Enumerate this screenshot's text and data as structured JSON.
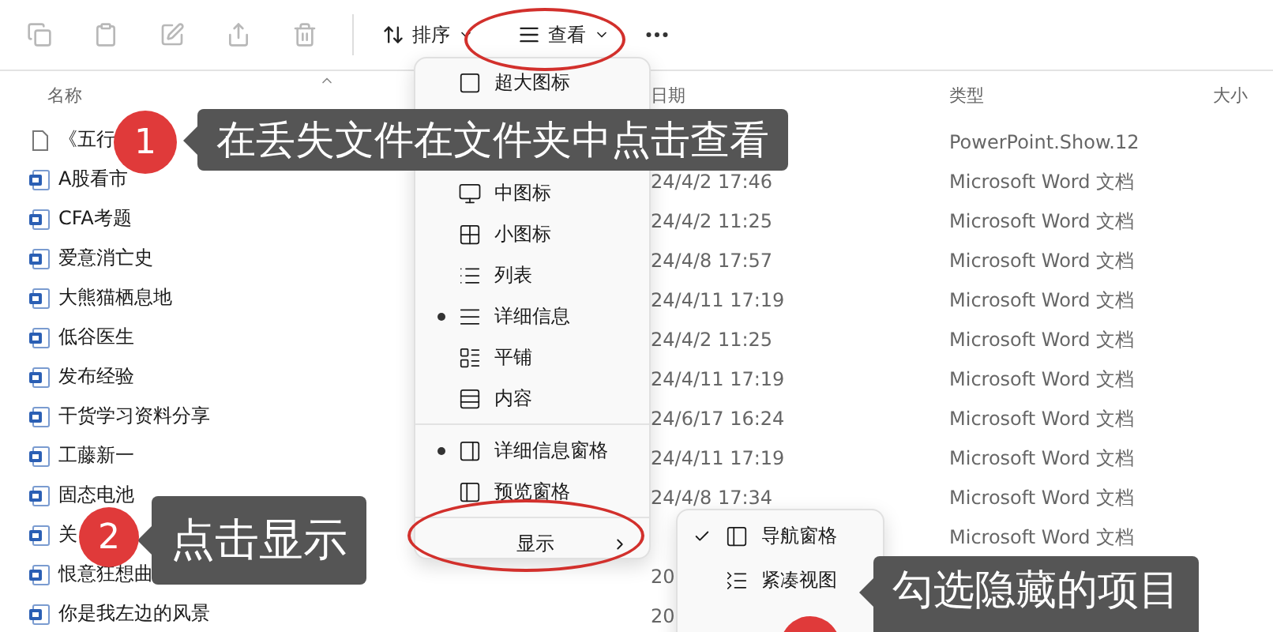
{
  "toolbar": {
    "icon_buttons": [
      {
        "disabled": true
      },
      {
        "disabled": true
      },
      {
        "disabled": true
      },
      {
        "disabled": true
      },
      {
        "disabled": true
      }
    ],
    "sort": {
      "label": "排序"
    },
    "view": {
      "label": "查看",
      "highlighted": true
    }
  },
  "table": {
    "columns": [
      "名称",
      "日期",
      "类型",
      "大小"
    ],
    "rows": [
      {
        "kind": "blank",
        "name": "《五行",
        "type": "PowerPoint.Show.12"
      },
      {
        "kind": "word",
        "name": "A股看市",
        "date": "24/4/2 17:46",
        "type": "Microsoft Word 文档"
      },
      {
        "kind": "word",
        "name": "CFA考题",
        "date": "24/4/2 11:25",
        "type": "Microsoft Word 文档"
      },
      {
        "kind": "word",
        "name": "爱意消亡史",
        "date": "24/4/8 17:57",
        "type": "Microsoft Word 文档"
      },
      {
        "kind": "word",
        "name": "大熊猫栖息地",
        "date": "24/4/11 17:19",
        "type": "Microsoft Word 文档"
      },
      {
        "kind": "word",
        "name": "低谷医生",
        "date": "24/4/2 11:25",
        "type": "Microsoft Word 文档"
      },
      {
        "kind": "word",
        "name": "发布经验",
        "date": "24/4/11 17:19",
        "type": "Microsoft Word 文档"
      },
      {
        "kind": "word",
        "name": "干货学习资料分享",
        "date": "24/6/17 16:24",
        "type": "Microsoft Word 文档"
      },
      {
        "kind": "word",
        "name": "工藤新一",
        "date": "24/4/11 17:19",
        "type": "Microsoft Word 文档"
      },
      {
        "kind": "word",
        "name": "固态电池",
        "date": "24/4/8 17:34",
        "type": "Microsoft Word 文档"
      },
      {
        "kind": "word",
        "name": "关",
        "type": "Microsoft Word 文档"
      },
      {
        "kind": "word",
        "name": "恨意狂想曲",
        "date": "20"
      },
      {
        "kind": "word",
        "name": "你是我左边的风景",
        "date": "20"
      }
    ]
  },
  "view_menu": {
    "items": [
      {
        "kind": "option",
        "label": "超大图标",
        "selected": false
      },
      {
        "kind": "option",
        "label": "中图标",
        "selected": false
      },
      {
        "kind": "option",
        "label": "小图标",
        "selected": false
      },
      {
        "kind": "option",
        "label": "列表",
        "selected": false
      },
      {
        "kind": "option",
        "label": "详细信息",
        "selected": true
      },
      {
        "kind": "option",
        "label": "平铺",
        "selected": false
      },
      {
        "kind": "option",
        "label": "内容",
        "selected": false
      },
      {
        "kind": "separator"
      },
      {
        "kind": "option",
        "label": "详细信息窗格",
        "selected": true
      },
      {
        "kind": "option",
        "label": "预览窗格",
        "selected": false
      },
      {
        "kind": "separator"
      },
      {
        "kind": "submenu",
        "label": "显示",
        "highlighted": true
      }
    ]
  },
  "show_submenu": {
    "items": [
      {
        "label": "导航窗格",
        "checked": true
      },
      {
        "label": "紧凑视图",
        "checked": false
      }
    ]
  },
  "annotations": [
    {
      "number": "1",
      "text": "在丢失文件在文件夹中点击查看"
    },
    {
      "number": "2",
      "text": "点击显示"
    },
    {
      "text": "勾选隐藏的项目"
    }
  ]
}
